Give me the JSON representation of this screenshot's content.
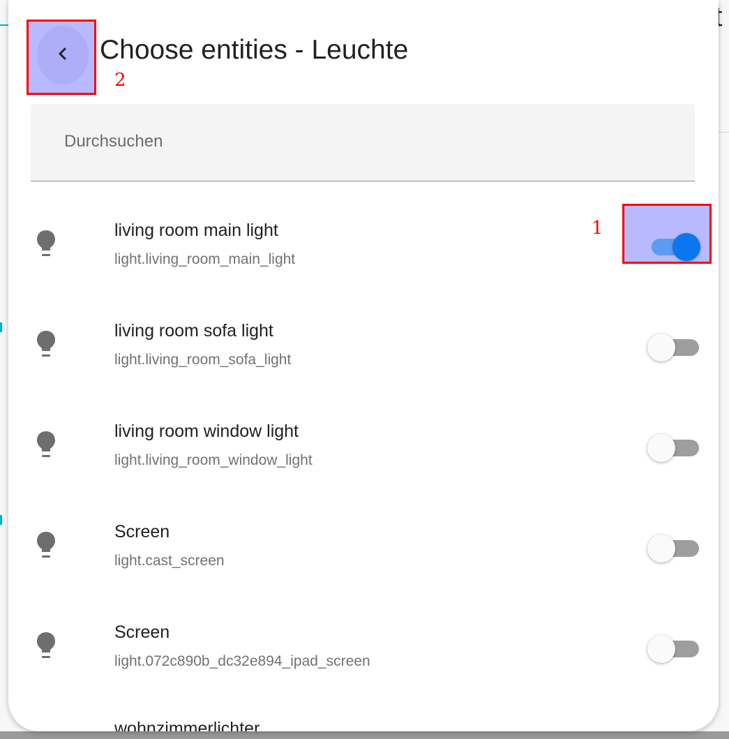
{
  "background": {
    "title_fragment": "ht"
  },
  "dialog": {
    "title": "Choose entities - Leuchte",
    "back_label": "2",
    "search": {
      "placeholder": "Durchsuchen",
      "value": ""
    },
    "highlight_label": "1",
    "entities": [
      {
        "name": "living room main light",
        "entity_id": "light.living_room_main_light",
        "enabled": true,
        "icon": "lightbulb-icon"
      },
      {
        "name": "living room sofa light",
        "entity_id": "light.living_room_sofa_light",
        "enabled": false,
        "icon": "lightbulb-icon"
      },
      {
        "name": "living room window light",
        "entity_id": "light.living_room_window_light",
        "enabled": false,
        "icon": "lightbulb-icon"
      },
      {
        "name": "Screen",
        "entity_id": "light.cast_screen",
        "enabled": false,
        "icon": "lightbulb-icon"
      },
      {
        "name": "Screen",
        "entity_id": "light.072c890b_dc32e894_ipad_screen",
        "enabled": false,
        "icon": "lightbulb-icon"
      }
    ],
    "partial_entity_name": "wohnzimmerlichter"
  },
  "colors": {
    "toggle_on_thumb": "#0a76f0",
    "toggle_on_track": "#5b9cf0",
    "toggle_off_track": "#9e9e9e",
    "annotation": "#ff0000",
    "annotation_fill": "#b9b9ff"
  }
}
